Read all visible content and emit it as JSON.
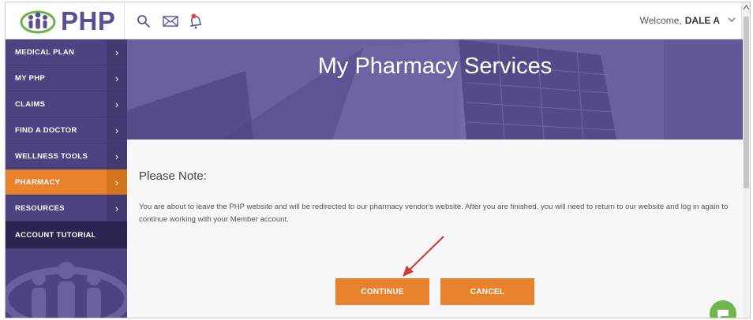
{
  "brand": {
    "logo_text": "PHP"
  },
  "topbar": {
    "icons": [
      "search-icon",
      "mail-icon",
      "bell-icon"
    ],
    "welcome_prefix": "Welcome,",
    "welcome_name": "DALE A",
    "dropdown_icon": "chevron-down-icon"
  },
  "sidebar": {
    "items": [
      {
        "label": "MEDICAL PLAN"
      },
      {
        "label": "MY PHP"
      },
      {
        "label": "CLAIMS"
      },
      {
        "label": "FIND A DOCTOR"
      },
      {
        "label": "WELLNESS TOOLS"
      },
      {
        "label": "PHARMACY"
      },
      {
        "label": "RESOURCES"
      },
      {
        "label": "ACCOUNT TUTORIAL"
      }
    ],
    "arrow_glyph": "›",
    "active": "PHARMACY"
  },
  "hero": {
    "title": "My Pharmacy Services"
  },
  "main": {
    "note_title": "Please Note:",
    "note_text": "You are about to leave the PHP website and will be redirected to our pharmacy vendor's website. After you are finished, you will need to return to our website and log in again to continue working with your Member account.",
    "continue_label": "CONTINUE",
    "cancel_label": "CANCEL"
  },
  "colors": {
    "brand_purple": "#4c4380",
    "accent_orange": "#e8822c",
    "chat_green": "#6fb64b",
    "arrow_red": "#d23b3b"
  }
}
